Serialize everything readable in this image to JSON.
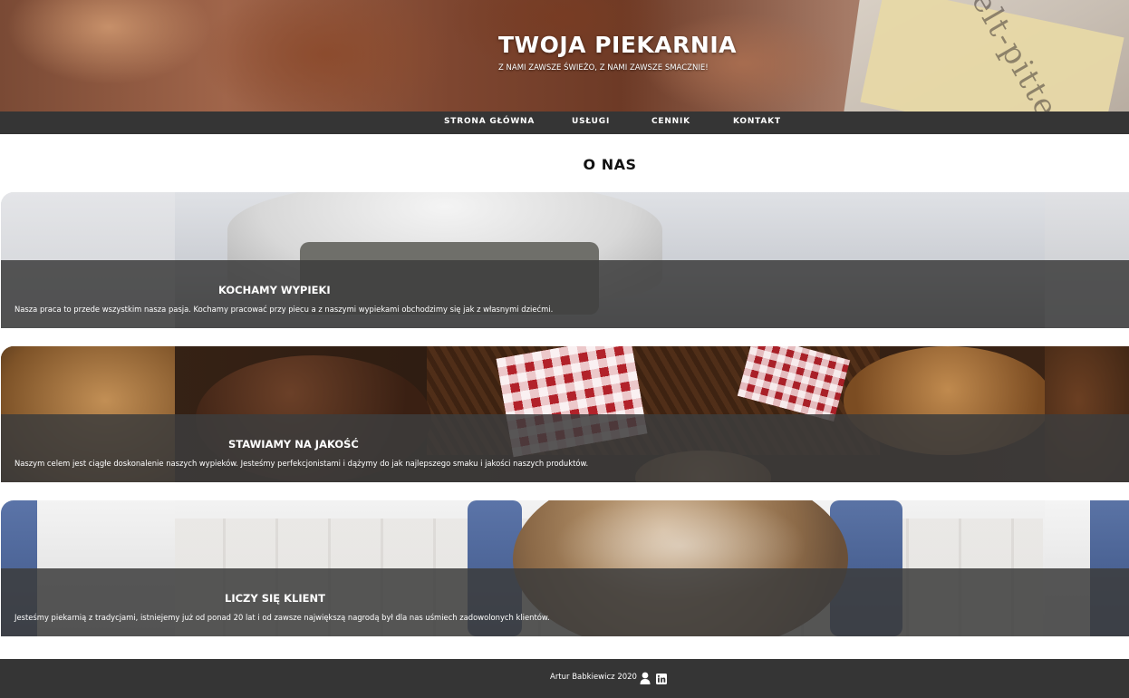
{
  "header": {
    "title": "TWOJA PIEKARNIA",
    "subtitle": "Z NAMI ZAWSZE ŚWIEŻO, Z NAMI ZAWSZE SMACZNIE!",
    "label_text": "Spelt-pitten"
  },
  "nav": {
    "items": [
      {
        "label": "STRONA GŁÓWNA"
      },
      {
        "label": "USŁUGI"
      },
      {
        "label": "CENNIK"
      },
      {
        "label": "KONTAKT"
      }
    ]
  },
  "about": {
    "title": "O NAS",
    "cards": [
      {
        "title": "KOCHAMY WYPIEKI",
        "text": "Nasza praca to przede wszystkim nasza pasja. Kochamy pracować przy piecu a z naszymi wypiekami obchodzimy się jak z własnymi dziećmi."
      },
      {
        "title": "STAWIAMY NA JAKOŚĆ",
        "text": "Naszym celem jest ciągłe doskonalenie naszych wypieków. Jesteśmy perfekcjonistami i dążymy do jak najlepszego smaku i jakości naszych produktów."
      },
      {
        "title": "LICZY SIĘ KLIENT",
        "text": "Jesteśmy piekarnią z tradycjami, istniejemy już od ponad 20 lat i od zawsze największą nagrodą był dla nas uśmiech zadowolonych klientów."
      }
    ]
  },
  "footer": {
    "credit": "Artur Babkiewicz 2020",
    "icons": [
      "user-icon",
      "linkedin-icon"
    ]
  },
  "colors": {
    "nav_bg": "#353535",
    "footer_bg": "#353535",
    "overlay": "rgba(60,60,60,0.86)"
  }
}
